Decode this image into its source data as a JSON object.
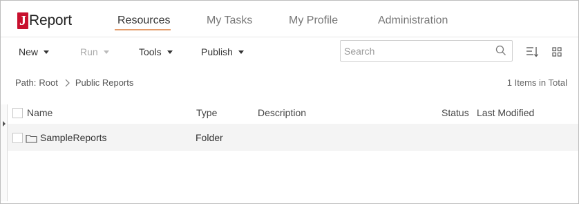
{
  "header": {
    "logo_letter": "J",
    "logo_text": "Report",
    "tabs": [
      {
        "label": "Resources",
        "active": true
      },
      {
        "label": "My Tasks",
        "active": false
      },
      {
        "label": "My Profile",
        "active": false
      },
      {
        "label": "Administration",
        "active": false
      }
    ],
    "accent_color": "#e39b6a",
    "brand_color": "#c8102e"
  },
  "toolbar": {
    "new_label": "New",
    "run_label": "Run",
    "tools_label": "Tools",
    "publish_label": "Publish",
    "search": {
      "value": "",
      "placeholder": "Search",
      "icon": "search-icon"
    },
    "sort_icon": "sort-icon",
    "view_icon": "grid-view-icon"
  },
  "breadcrumb": {
    "path_label": "Path:",
    "root": "Root",
    "current": "Public Reports"
  },
  "items_total": "1 Items in Total",
  "table": {
    "columns": [
      "Name",
      "Type",
      "Description",
      "Status",
      "Last Modified"
    ],
    "rows": [
      {
        "name": "SampleReports",
        "type": "Folder",
        "description": "",
        "status": "",
        "last_modified": "",
        "icon": "folder-icon"
      }
    ]
  }
}
